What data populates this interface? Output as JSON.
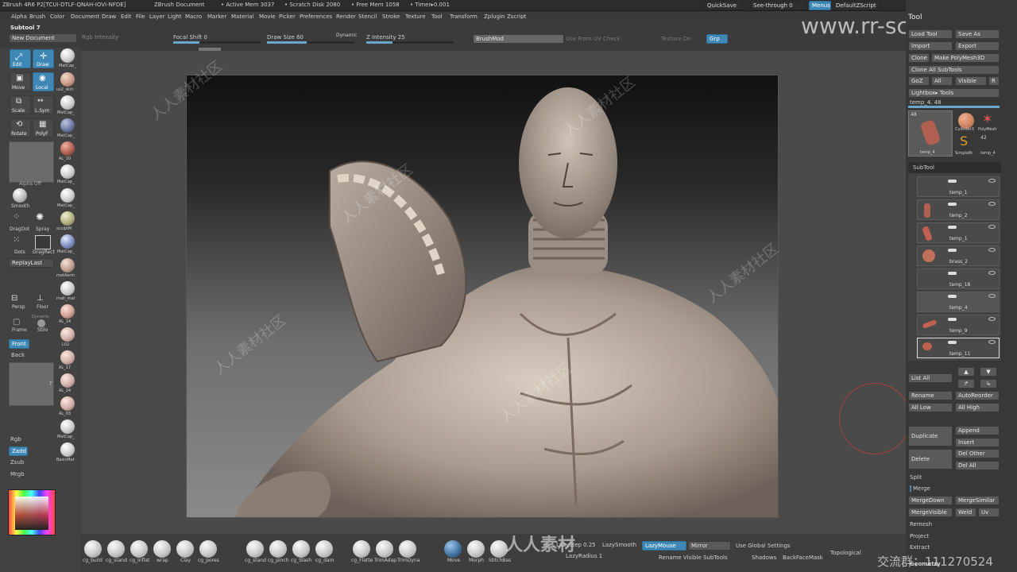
{
  "topbar": {
    "app": "ZBrush 4R6 P2[TCUI-DTLF-QNAH-IOVI-NFDE]",
    "doc": "ZBrush Document",
    "active_mem": "• Active Mem 3037",
    "scratch": "• Scratch Disk 2080",
    "free_mem": "• Free Mem 1058",
    "timer": "• Timer▸0.001",
    "quicksave": "QuickSave",
    "seethrough": "See-through  0",
    "menus": "Menus",
    "defaultzscript": "DefaultZScript"
  },
  "menus": [
    "Alpha",
    "Brush",
    "Color",
    "Document",
    "Draw",
    "Edit",
    "File",
    "Layer",
    "Light",
    "Macro",
    "Marker",
    "Material",
    "Movie",
    "Picker",
    "Preferences",
    "Render",
    "Stencil",
    "Stroke",
    "Texture",
    "Tool",
    "Transform",
    "Zplugin",
    "Zscript"
  ],
  "shelf": {
    "subtool": "Subtool 7",
    "new_document": "New Document",
    "rgb_intensity": "Rgb Intensity",
    "focal_shift": "Focal Shift 0",
    "draw_size": "Draw Size 60",
    "dynamic": "Dynamic",
    "z_intensity": "Z Intensity 25",
    "brushmod": "BrushMod",
    "uv_check": "Use From UV Check",
    "texture_on": "Texture On",
    "grp": "Grp",
    "focal_value": 0.3,
    "draw_value": 0.45,
    "zint_value": 0.3
  },
  "left": {
    "edit": "Edit",
    "draw": "Draw",
    "move": "Move",
    "local": "Local",
    "scale": "Scale",
    "lsym": "L.Sym",
    "rotate": "Rotate",
    "polyf": "PolyF",
    "alpha_off": "Alpha Off",
    "smooth": "Smooth",
    "dragdot": "DragDot",
    "spray": "Spray",
    "dots": "Dots",
    "dragrect": "DragRect",
    "replaylast": "ReplayLast",
    "persp": "Persp",
    "floor": "Floor",
    "frame": "Frame",
    "stilo": "Stilo",
    "symmetry": "Dynamic",
    "front": "Front",
    "back": "Back",
    "rgb": "Rgb",
    "zadd": "Zadd",
    "zsub": "Zsub",
    "mrgb": "Mrgb",
    "t_label": "T",
    "materials": [
      "MatCap_",
      "us2_skin",
      "MatCap_",
      "MatCap_",
      "AL_10",
      "MatCap_",
      "MatCap_",
      "sculptM",
      "MatCap_",
      "matAerm",
      "mah_mat",
      "AL_14",
      "L02",
      "AL_17",
      "AL_24",
      "AL_03",
      "MatCap_",
      "BasicMat"
    ]
  },
  "tool": {
    "title": "Tool",
    "load": "Load Tool",
    "save": "Save As",
    "import": "Import",
    "export": "Export",
    "clone": "Clone",
    "make_polymesh": "Make PolyMesh3D",
    "clone_all": "Clone  All SubTools",
    "goz": "GoZ",
    "all": "All",
    "visible": "Visible",
    "r": "R",
    "lightbox": "Lightbox▸ Tools",
    "temp": "temp_4. 48",
    "thumb_num": "48",
    "cyl": "Cylinder3",
    "polymesh": "PolyMesh",
    "simple": "SimpleBr",
    "temp4": "temp_4",
    "temp4b": "temp_4",
    "num42": "42",
    "subtool": "SubTool",
    "items": [
      "temp_1",
      "temp_2",
      "temp_1",
      "brass_2",
      "temp_18",
      "temp_4",
      "temp_9",
      "temp_11"
    ],
    "list_all": "List All",
    "rename": "Rename",
    "autoreorder": "AutoReorder",
    "all_low": "All Low",
    "all_high": "All High",
    "duplicate": "Duplicate",
    "append": "Append",
    "insert": "Insert",
    "delete": "Delete",
    "del_other": "Del Other",
    "del_all": "Del All",
    "split": "Split",
    "merge": "Merge",
    "mergedown": "MergeDown",
    "mergesimilar": "MergeSimilar",
    "mergevisible": "MergeVisible",
    "weld": "Weld",
    "uv": "Uv",
    "remesh": "Remesh",
    "project": "Project",
    "extract": "Extract",
    "geometry": "Geometry"
  },
  "bottom": {
    "brushes": [
      "cg_build",
      "cg_stand",
      "cg_inflat",
      "wrap",
      "Clay",
      "cg_pores",
      "cg_stand",
      "cg_pinch",
      "cg_Slash",
      "cg_dam",
      "cg_Flatte",
      "TrimAdap",
      "TrimDyna",
      "Move",
      "Morph",
      "StitchBas"
    ],
    "lazystep": "LazyStep 0.25",
    "lazysmooth": "LazySmooth",
    "lazymouse": "LazyMouse",
    "mirror": "Mirror",
    "use_global": "Use Global Settings",
    "lazyradius": "LazyRadius 1",
    "rename_visible": "Rename Visible SubTools",
    "shadows": "Shadows",
    "backface": "BackFaceMask",
    "topological": "Topological"
  },
  "watermark": {
    "site": "www.rr-sc.com",
    "cn": "人人素材社区",
    "bottom_id": "交流群：111270524",
    "logo": "人人素材"
  }
}
